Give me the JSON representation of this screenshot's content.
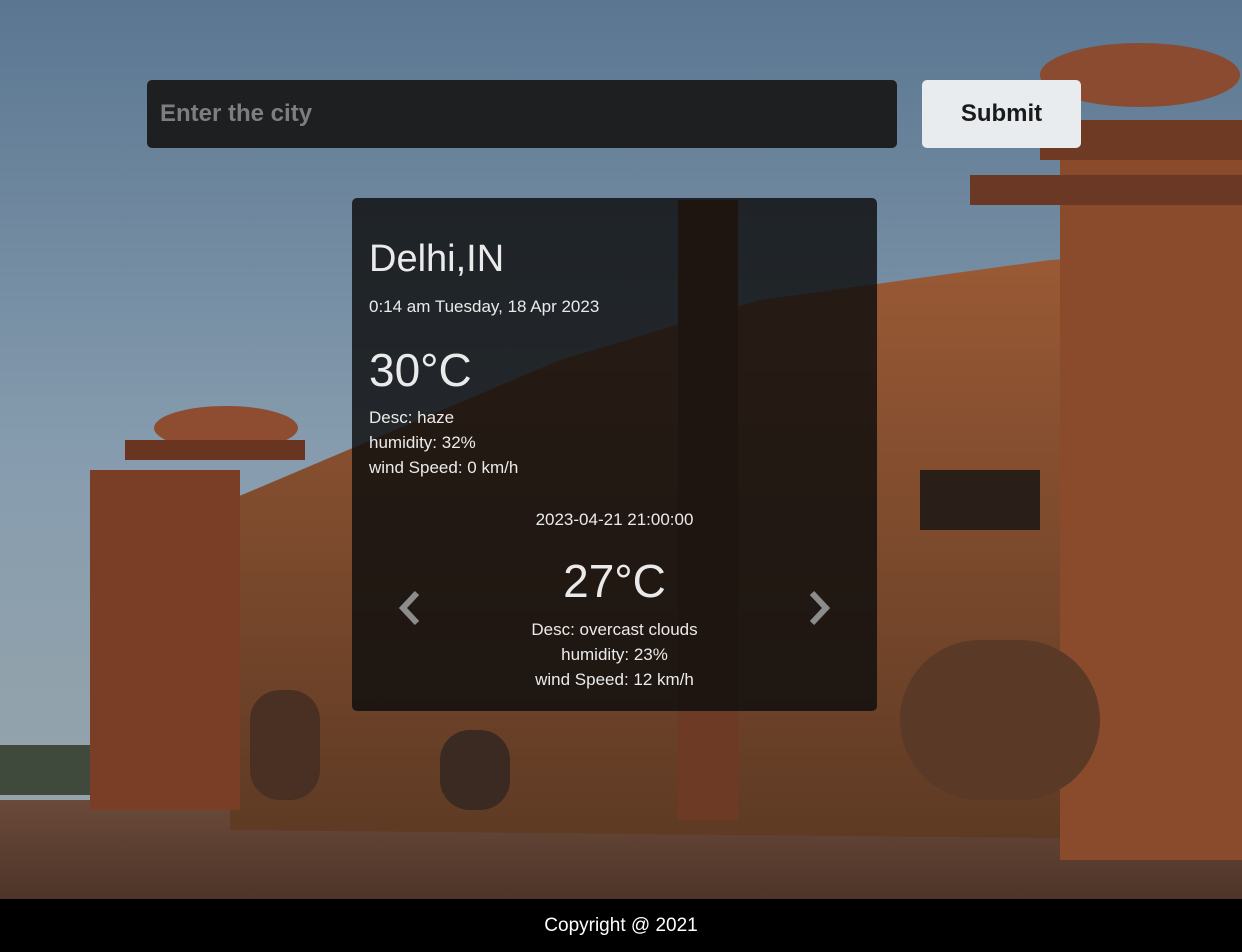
{
  "search": {
    "placeholder": "Enter the city",
    "value": "",
    "submit_label": "Submit"
  },
  "current": {
    "city": "Delhi,IN",
    "datetime": "0:14 am Tuesday, 18 Apr 2023",
    "temperature": "30°C",
    "desc": "Desc: haze",
    "humidity": "humidity: 32%",
    "wind": "wind Speed: 0 km/h"
  },
  "forecast": {
    "datetime": "2023-04-21 21:00:00",
    "temperature": "27°C",
    "desc": "Desc: overcast clouds",
    "humidity": "humidity: 23%",
    "wind": "wind Speed: 12 km/h"
  },
  "carousel": {
    "prev_icon": "chevron-left-icon",
    "next_icon": "chevron-right-icon"
  },
  "footer": {
    "text": "Copyright @ 2021"
  },
  "colors": {
    "card_bg": "#0e0e0e",
    "input_bg": "#1d1f21",
    "button_bg": "#e9ecef",
    "footer_bg": "#000000"
  }
}
